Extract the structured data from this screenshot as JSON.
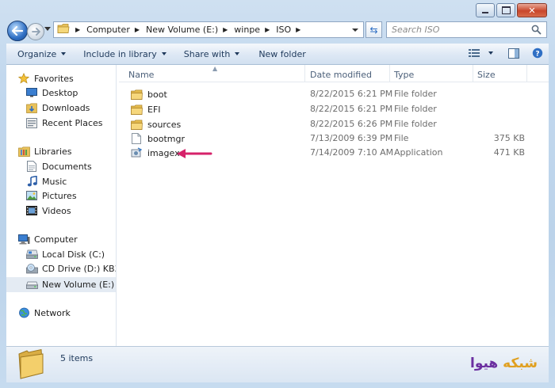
{
  "address_bar": {
    "crumbs": [
      "Computer",
      "New Volume (E:)",
      "winpe",
      "ISO"
    ]
  },
  "search": {
    "placeholder": "Search ISO"
  },
  "toolbar": {
    "organize": "Organize",
    "include_in_library": "Include in library",
    "share_with": "Share with",
    "new_folder": "New folder"
  },
  "nav": {
    "favorites": "Favorites",
    "desktop": "Desktop",
    "downloads": "Downloads",
    "recent_places": "Recent Places",
    "libraries": "Libraries",
    "documents": "Documents",
    "music": "Music",
    "pictures": "Pictures",
    "videos": "Videos",
    "computer": "Computer",
    "local_disk": "Local Disk (C:)",
    "cd_drive": "CD Drive (D:) KB3AIK",
    "new_volume": "New Volume (E:)",
    "network": "Network"
  },
  "columns": {
    "name": "Name",
    "date": "Date modified",
    "type": "Type",
    "size": "Size"
  },
  "files": [
    {
      "name": "boot",
      "date": "8/22/2015 6:21 PM",
      "type": "File folder",
      "size": "",
      "icon": "folder-icon"
    },
    {
      "name": "EFI",
      "date": "8/22/2015 6:21 PM",
      "type": "File folder",
      "size": "",
      "icon": "folder-icon"
    },
    {
      "name": "sources",
      "date": "8/22/2015 6:26 PM",
      "type": "File folder",
      "size": "",
      "icon": "folder-icon"
    },
    {
      "name": "bootmgr",
      "date": "7/13/2009 6:39 PM",
      "type": "File",
      "size": "375 KB",
      "icon": "file-icon"
    },
    {
      "name": "imagex",
      "date": "7/14/2009 7:10 AM",
      "type": "Application",
      "size": "471 KB",
      "icon": "application-icon"
    }
  ],
  "status": {
    "item_count": "5 items"
  },
  "watermark": {
    "part1": "هیوا",
    "part2": "شبکه"
  },
  "colors": {
    "annotation_arrow": "#d6226a",
    "selection": "#e4ebf3"
  }
}
